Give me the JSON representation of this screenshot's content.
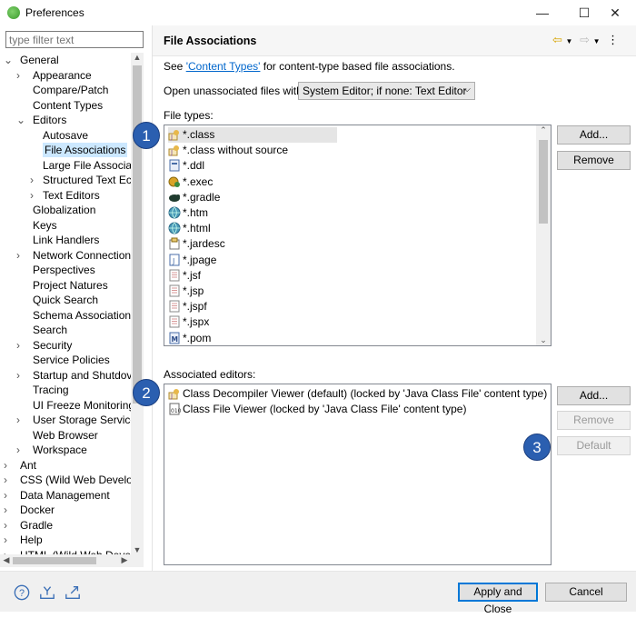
{
  "window": {
    "title": "Preferences",
    "minimize": "—",
    "maximize": "☐",
    "close": "✕"
  },
  "filter": {
    "placeholder": "type filter text"
  },
  "tree": [
    {
      "label": "General",
      "level": 0,
      "twisty": "v"
    },
    {
      "label": "Appearance",
      "level": 1,
      "twisty": ">"
    },
    {
      "label": "Compare/Patch",
      "level": 1
    },
    {
      "label": "Content Types",
      "level": 1
    },
    {
      "label": "Editors",
      "level": 1,
      "twisty": "v"
    },
    {
      "label": "Autosave",
      "level": 2
    },
    {
      "label": "File Associations",
      "level": 2,
      "selected": true
    },
    {
      "label": "Large File Associa",
      "level": 2
    },
    {
      "label": "Structured Text Ec",
      "level": 2,
      "twisty": ">"
    },
    {
      "label": "Text Editors",
      "level": 2,
      "twisty": ">"
    },
    {
      "label": "Globalization",
      "level": 1
    },
    {
      "label": "Keys",
      "level": 1
    },
    {
      "label": "Link Handlers",
      "level": 1
    },
    {
      "label": "Network Connection",
      "level": 1,
      "twisty": ">"
    },
    {
      "label": "Perspectives",
      "level": 1
    },
    {
      "label": "Project Natures",
      "level": 1
    },
    {
      "label": "Quick Search",
      "level": 1
    },
    {
      "label": "Schema Associations",
      "level": 1
    },
    {
      "label": "Search",
      "level": 1
    },
    {
      "label": "Security",
      "level": 1,
      "twisty": ">"
    },
    {
      "label": "Service Policies",
      "level": 1
    },
    {
      "label": "Startup and Shutdov",
      "level": 1,
      "twisty": ">"
    },
    {
      "label": "Tracing",
      "level": 1
    },
    {
      "label": "UI Freeze Monitoring",
      "level": 1
    },
    {
      "label": "User Storage Service",
      "level": 1,
      "twisty": ">"
    },
    {
      "label": "Web Browser",
      "level": 1
    },
    {
      "label": "Workspace",
      "level": 1,
      "twisty": ">"
    },
    {
      "label": "Ant",
      "level": 0,
      "twisty": ">"
    },
    {
      "label": "CSS (Wild Web Develop",
      "level": 0,
      "twisty": ">"
    },
    {
      "label": "Data Management",
      "level": 0,
      "twisty": ">"
    },
    {
      "label": "Docker",
      "level": 0,
      "twisty": ">"
    },
    {
      "label": "Gradle",
      "level": 0,
      "twisty": ">"
    },
    {
      "label": "Help",
      "level": 0,
      "twisty": ">"
    },
    {
      "label": "HTML (Wild Web Devel",
      "level": 0,
      "twisty": ">"
    }
  ],
  "page": {
    "title": "File Associations",
    "see_prefix": "See ",
    "see_link": "'Content Types'",
    "see_suffix": " for content-type based file associations.",
    "open_label": "Open unassociated files with:",
    "open_value": "System Editor; if none: Text Editor",
    "file_types_label": "File types:",
    "associated_label": "Associated editors:"
  },
  "file_types": [
    {
      "label": "*.class",
      "icon": "class-file-icon",
      "selected": true
    },
    {
      "label": "*.class without source",
      "icon": "class-file-icon"
    },
    {
      "label": "*.ddl",
      "icon": "ddl-file-icon"
    },
    {
      "label": "*.exec",
      "icon": "exec-file-icon"
    },
    {
      "label": "*.gradle",
      "icon": "gradle-elephant-icon"
    },
    {
      "label": "*.htm",
      "icon": "globe-icon"
    },
    {
      "label": "*.html",
      "icon": "globe-icon"
    },
    {
      "label": "*.jardesc",
      "icon": "jardesc-file-icon"
    },
    {
      "label": "*.jpage",
      "icon": "jpage-file-icon"
    },
    {
      "label": "*.jsf",
      "icon": "text-file-icon"
    },
    {
      "label": "*.jsp",
      "icon": "text-file-icon"
    },
    {
      "label": "*.jspf",
      "icon": "text-file-icon"
    },
    {
      "label": "*.jspx",
      "icon": "text-file-icon"
    },
    {
      "label": "*.pom",
      "icon": "maven-file-icon"
    }
  ],
  "associated_editors": [
    {
      "label": "Class Decompiler Viewer (default) (locked by 'Java Class File' content type)",
      "icon": "class-file-icon"
    },
    {
      "label": "Class File Viewer (locked by 'Java Class File' content type)",
      "icon": "class-file-viewer-icon"
    }
  ],
  "buttons": {
    "add_ft": "Add...",
    "remove_ft": "Remove",
    "add_ae": "Add...",
    "remove_ae": "Remove",
    "default_ae": "Default",
    "apply_close": "Apply and Close",
    "cancel": "Cancel"
  },
  "badges": [
    "1",
    "2",
    "3"
  ],
  "colors": {
    "selection": "#cce8ff",
    "badge": "#2b5fb0",
    "link": "#0066cc"
  }
}
